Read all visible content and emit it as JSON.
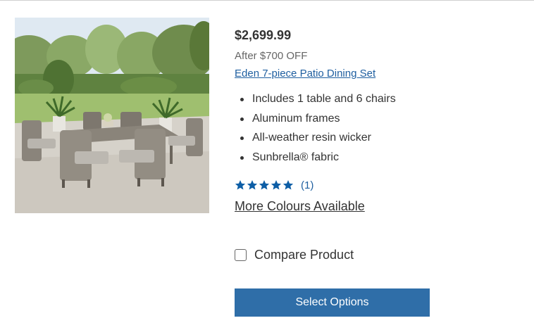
{
  "product": {
    "price": "$2,699.99",
    "discount": "After $700 OFF",
    "title": "Eden 7-piece Patio Dining Set",
    "features": [
      "Includes 1 table and 6 chairs",
      "Aluminum frames",
      "All-weather resin wicker",
      "Sunbrella® fabric"
    ],
    "rating": {
      "stars": 5,
      "max_stars": 5,
      "review_count": "(1)"
    },
    "more_colours": "More Colours Available",
    "compare_label": "Compare Product",
    "compare_checked": false,
    "select_button": "Select Options",
    "image_icon": "patio-dining-set-photo"
  },
  "colors": {
    "link": "#1f5fa0",
    "star": "#0d5ea6",
    "button": "#2f6ea8",
    "button_text": "#ffffff",
    "text": "#333333",
    "muted": "#666666"
  }
}
